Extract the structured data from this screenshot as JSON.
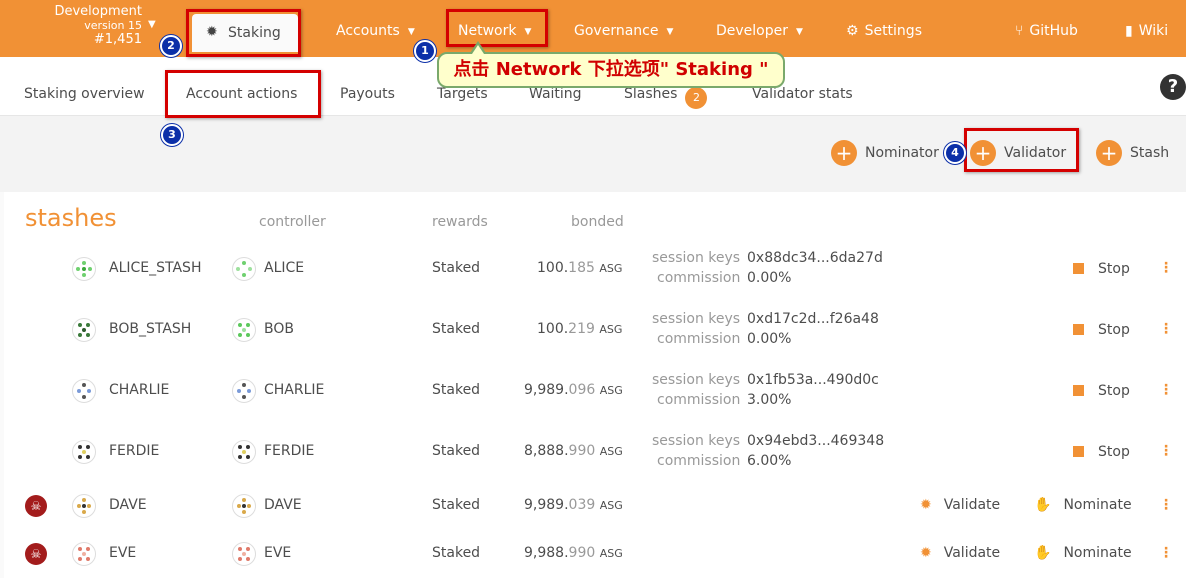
{
  "chain": {
    "name": "Development",
    "version": "version 15",
    "block": "#1,451"
  },
  "nav": {
    "staking": "Staking",
    "accounts": "Accounts",
    "network": "Network",
    "governance": "Governance",
    "developer": "Developer",
    "settings": "Settings",
    "github": "GitHub",
    "wiki": "Wiki"
  },
  "subnav": {
    "overview": "Staking overview",
    "account_actions": "Account actions",
    "payouts": "Payouts",
    "targets": "Targets",
    "waiting": "Waiting",
    "slashes": "Slashes",
    "slashes_count": "2",
    "validator_stats": "Validator stats"
  },
  "actions": {
    "nominator": "Nominator",
    "validator": "Validator",
    "stash": "Stash"
  },
  "table": {
    "title": "stashes",
    "headers": {
      "controller": "controller",
      "rewards": "rewards",
      "bonded": "bonded"
    },
    "labels": {
      "session_keys": "session keys",
      "commission": "commission",
      "unit": "ASG"
    },
    "rows": [
      {
        "stash": "ALICE_STASH",
        "controller": "ALICE",
        "rewards": "Staked",
        "bonded_int": "100.",
        "bonded_frac": "185",
        "session_keys": "0x88dc34...6da27d",
        "commission": "0.00%",
        "action": "Stop"
      },
      {
        "stash": "BOB_STASH",
        "controller": "BOB",
        "rewards": "Staked",
        "bonded_int": "100.",
        "bonded_frac": "219",
        "session_keys": "0xd17c2d...f26a48",
        "commission": "0.00%",
        "action": "Stop"
      },
      {
        "stash": "CHARLIE",
        "controller": "CHARLIE",
        "rewards": "Staked",
        "bonded_int": "9,989.",
        "bonded_frac": "096",
        "session_keys": "0x1fb53a...490d0c",
        "commission": "3.00%",
        "action": "Stop"
      },
      {
        "stash": "FERDIE",
        "controller": "FERDIE",
        "rewards": "Staked",
        "bonded_int": "8,888.",
        "bonded_frac": "990",
        "session_keys": "0x94ebd3...469348",
        "commission": "6.00%",
        "action": "Stop"
      },
      {
        "stash": "DAVE",
        "controller": "DAVE",
        "rewards": "Staked",
        "bonded_int": "9,989.",
        "bonded_frac": "039",
        "validate": "Validate",
        "nominate": "Nominate"
      },
      {
        "stash": "EVE",
        "controller": "EVE",
        "rewards": "Staked",
        "bonded_int": "9,988.",
        "bonded_frac": "990",
        "validate": "Validate",
        "nominate": "Nominate"
      }
    ]
  },
  "annotations": {
    "callout_text": "点击 Network 下拉选项\" Staking \"",
    "n1": "1",
    "n2": "2",
    "n3": "3",
    "n4": "4"
  },
  "colors": {
    "accent": "#f19135",
    "annotation_red": "#d40000",
    "marker_blue": "#0b2fa8"
  }
}
